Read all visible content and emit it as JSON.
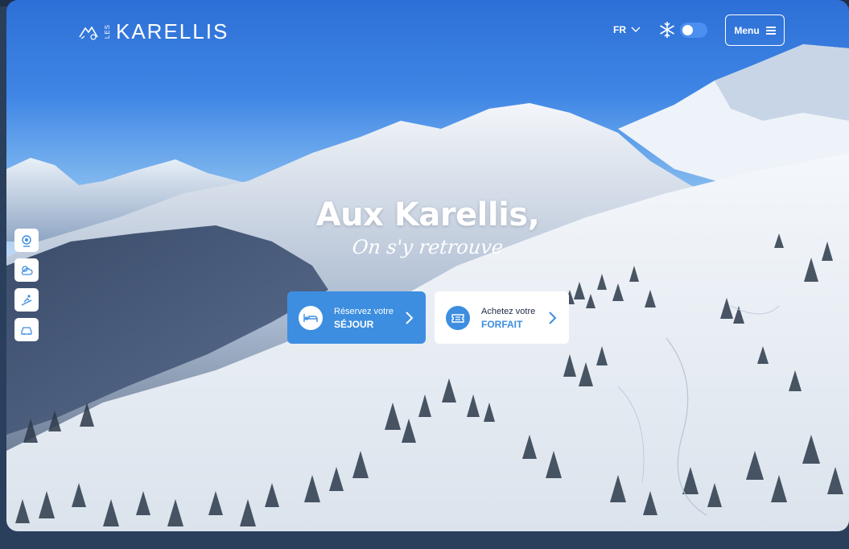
{
  "logo": {
    "prefix": "LES",
    "name": "KARELLIS"
  },
  "header": {
    "language": "FR",
    "menu_label": "Menu",
    "season_icon": "snowflake-icon",
    "season_toggle_on": true
  },
  "hero": {
    "title": "Aux Karellis,",
    "subtitle": "On s'y retrouve"
  },
  "cta": [
    {
      "line1": "Réservez votre",
      "line2": "SÉJOUR",
      "icon": "bed-icon"
    },
    {
      "line1": "Achetez votre",
      "line2": "FORFAIT",
      "icon": "ticket-icon"
    }
  ],
  "side_nav": [
    {
      "icon": "webcam-icon"
    },
    {
      "icon": "weather-icon"
    },
    {
      "icon": "ski-slope-icon"
    },
    {
      "icon": "car-icon"
    }
  ],
  "colors": {
    "accent": "#3d8ee0",
    "sky": "#2d6fd6",
    "text_dark": "#1f2a44"
  }
}
